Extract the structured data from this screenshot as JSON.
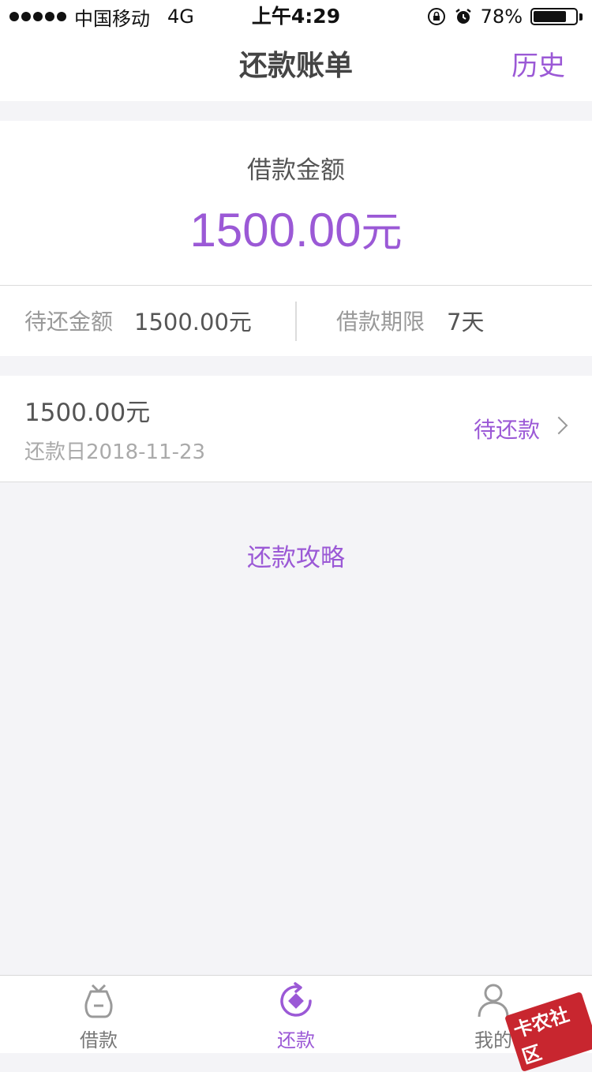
{
  "status_bar": {
    "carrier": "中国移动",
    "network": "4G",
    "time": "上午4:29",
    "battery_percent": "78%",
    "battery_level": 0.78
  },
  "nav": {
    "title": "还款账单",
    "history_label": "历史"
  },
  "summary": {
    "amount_label": "借款金额",
    "amount_value": "1500.00",
    "amount_unit": "元",
    "pending_label": "待还金额",
    "pending_value": "1500.00元",
    "term_label": "借款期限",
    "term_value": "7天"
  },
  "bill": {
    "amount": "1500.00元",
    "due_date": "还款日2018-11-23",
    "status": "待还款"
  },
  "strategy_label": "还款攻略",
  "tabs": [
    {
      "label": "借款",
      "icon": "bag-icon",
      "active": false
    },
    {
      "label": "还款",
      "icon": "repay-icon",
      "active": true
    },
    {
      "label": "我的",
      "icon": "user-icon",
      "active": false
    }
  ],
  "watermark": "卡农社区",
  "colors": {
    "accent": "#9b59d6",
    "background": "#f4f4f7"
  }
}
